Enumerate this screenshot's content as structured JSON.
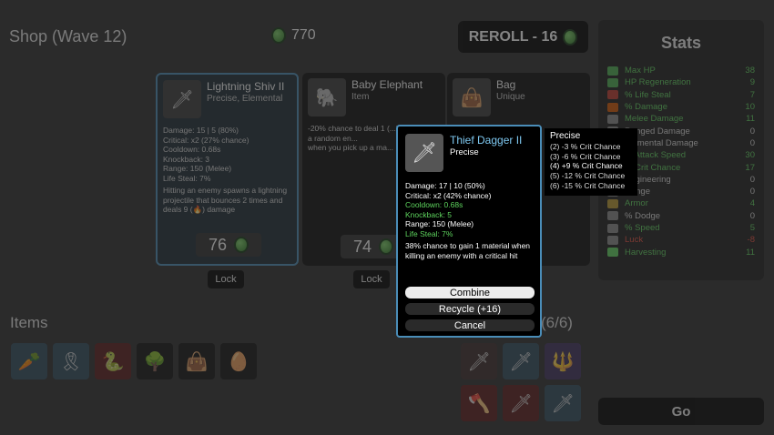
{
  "header": {
    "shop_title": "Shop (Wave 12)",
    "materials": "770",
    "reroll_label": "REROLL - 16"
  },
  "stats": {
    "title": "Stats",
    "rows": [
      {
        "name": "Max HP",
        "value": "38",
        "color": "#5dd35d",
        "icon_color": "#4caf50"
      },
      {
        "name": "HP Regeneration",
        "value": "9",
        "color": "#5dd35d",
        "icon_color": "#4caf50"
      },
      {
        "name": "% Life Steal",
        "value": "7",
        "color": "#5dd35d",
        "icon_color": "#c0392b"
      },
      {
        "name": "% Damage",
        "value": "10",
        "color": "#5dd35d",
        "icon_color": "#d35400"
      },
      {
        "name": "Melee Damage",
        "value": "11",
        "color": "#5dd35d",
        "icon_color": "#888"
      },
      {
        "name": "Ranged Damage",
        "value": "0",
        "color": "#dddddd",
        "icon_color": "#888"
      },
      {
        "name": "Elemental Damage",
        "value": "0",
        "color": "#dddddd",
        "icon_color": "#888"
      },
      {
        "name": "% Attack Speed",
        "value": "30",
        "color": "#5dd35d",
        "icon_color": "#888"
      },
      {
        "name": "% Crit Chance",
        "value": "17",
        "color": "#5dd35d",
        "icon_color": "#888"
      },
      {
        "name": "Engineering",
        "value": "0",
        "color": "#dddddd",
        "icon_color": "#888"
      },
      {
        "name": "Range",
        "value": "0",
        "color": "#dddddd",
        "icon_color": "#888"
      },
      {
        "name": "Armor",
        "value": "4",
        "color": "#5dd35d",
        "icon_color": "#b8962e"
      },
      {
        "name": "% Dodge",
        "value": "0",
        "color": "#dddddd",
        "icon_color": "#888"
      },
      {
        "name": "% Speed",
        "value": "5",
        "color": "#5dd35d",
        "icon_color": "#888"
      },
      {
        "name": "Luck",
        "value": "-8",
        "color": "#e74c3c",
        "icon_color": "#888"
      },
      {
        "name": "Harvesting",
        "value": "11",
        "color": "#5dd35d",
        "icon_color": "#5dd35d"
      }
    ]
  },
  "cards": [
    {
      "name": "Lightning Shiv II",
      "type": "Precise, Elemental",
      "icon": "shiv-icon",
      "lines": [
        "Damage: 15 | 5 (80%)",
        "Critical: x2 (27% chance)",
        "Cooldown: 0.68s",
        "Knockback: 3",
        "Range: 150 (Melee)",
        "Life Steal: 7%"
      ],
      "effect": "Hitting an enemy spawns a lightning projectile that bounces 2 times and deals 9 (🔥) damage",
      "price": "76",
      "lock_label": "Lock"
    },
    {
      "name": "Baby Elephant",
      "type": "Item",
      "icon": "elephant-icon",
      "lines": [
        "-20% chance to deal 1 (...) damage to a random en...",
        "when you pick up a ma..."
      ],
      "effect": "",
      "price": "74",
      "lock_label": "Lock"
    },
    {
      "name": "Bag",
      "type": "Unique",
      "icon": "bag-icon",
      "lines": [],
      "effect": "",
      "price": "",
      "lock_label": ""
    }
  ],
  "popup": {
    "name": "Thief Dagger II",
    "type": "Precise",
    "icon": "dagger-icon",
    "damage": "Damage: 17 | 10 (50%)",
    "critical": "Critical: x2 (42% chance)",
    "cooldown": "Cooldown: 0.68s",
    "knockback": "Knockback: 5",
    "range": "Range: 150 (Melee)",
    "life_steal": "Life Steal: 7%",
    "effect": "38% chance to gain 1 material when killing an enemy with a critical hit",
    "combine_label": "Combine",
    "recycle_label": "Recycle (+16)",
    "cancel_label": "Cancel"
  },
  "tooltip": {
    "title": "Precise",
    "rows": [
      "(2) -3 % Crit Chance",
      "(3) -6 % Crit Chance",
      "(4) +9 % Crit Chance",
      "(5) -12 % Crit Chance",
      "(6) -15 % Crit Chance"
    ]
  },
  "items_section": {
    "title": "Items",
    "weapons_count": "(6/6)"
  },
  "items": [
    "carrot-icon",
    "belt-icon",
    "snake-icon",
    "tree-icon",
    "bag-icon",
    "egg-icon"
  ],
  "weapons": [
    "dagger-icon",
    "dagger-icon",
    "spear-icon",
    "axe-icon",
    "dagger-icon",
    "dagger-icon"
  ],
  "go_label": "Go"
}
